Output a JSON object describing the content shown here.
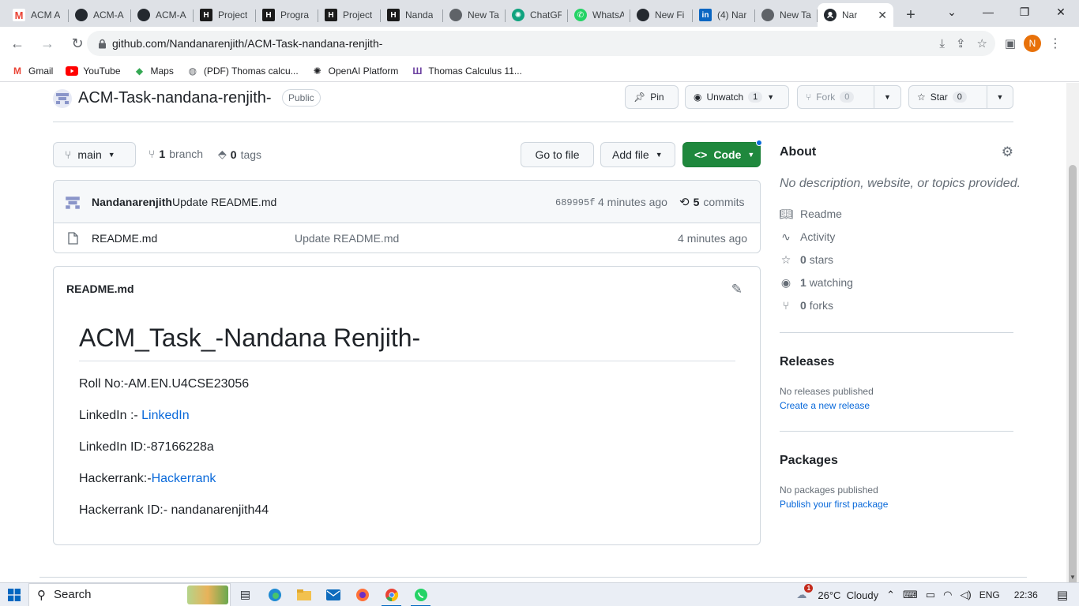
{
  "browser": {
    "tabs": [
      {
        "title": "ACM A",
        "icon": "gmail-icon",
        "color": "#ea4335"
      },
      {
        "title": "ACM-A",
        "icon": "github-icon",
        "color": "#24292f"
      },
      {
        "title": "ACM-A",
        "icon": "github-icon",
        "color": "#24292f"
      },
      {
        "title": "Project",
        "icon": "hackerrank-icon",
        "color": "#1a1a1a"
      },
      {
        "title": "Progra",
        "icon": "hackerrank-icon",
        "color": "#1a1a1a"
      },
      {
        "title": "Project",
        "icon": "hackerrank-icon",
        "color": "#1a1a1a"
      },
      {
        "title": "Nanda",
        "icon": "hackerrank-icon",
        "color": "#1a1a1a"
      },
      {
        "title": "New Ta",
        "icon": "chrome-icon",
        "color": "#5f6368"
      },
      {
        "title": "ChatGF",
        "icon": "chatgpt-icon",
        "color": "#10a37f"
      },
      {
        "title": "WhatsA",
        "icon": "whatsapp-icon",
        "color": "#25d366"
      },
      {
        "title": "New Fi",
        "icon": "github-icon",
        "color": "#24292f"
      },
      {
        "title": "(4) Nar",
        "icon": "linkedin-icon",
        "color": "#0a66c2"
      },
      {
        "title": "New Ta",
        "icon": "chrome-icon",
        "color": "#5f6368"
      }
    ],
    "active_tab": {
      "title": "Nar",
      "icon": "github-icon"
    },
    "url": "github.com/Nandanarenjith/ACM-Task-nandana-renjith-",
    "profile_initial": "N",
    "bookmarks": [
      {
        "label": "Gmail",
        "icon": "gmail-icon"
      },
      {
        "label": "YouTube",
        "icon": "youtube-icon"
      },
      {
        "label": "Maps",
        "icon": "maps-icon"
      },
      {
        "label": "(PDF) Thomas calcu...",
        "icon": "globe-icon"
      },
      {
        "label": "OpenAI Platform",
        "icon": "openai-icon"
      },
      {
        "label": "Thomas Calculus 11...",
        "icon": "book-icon"
      }
    ]
  },
  "repo": {
    "name": "ACM-Task-nandana-renjith-",
    "visibility": "Public",
    "pin_label": "Pin",
    "unwatch_label": "Unwatch",
    "watch_count": "1",
    "fork_label": "Fork",
    "fork_count": "0",
    "star_label": "Star",
    "star_count": "0",
    "branch_name": "main",
    "branch_count": "1",
    "branch_word": "branch",
    "tag_count": "0",
    "tag_word": "tags",
    "go_to_file": "Go to file",
    "add_file": "Add file",
    "code_label": "Code"
  },
  "commit": {
    "author": "Nandanarenjith",
    "message": "Update README.md",
    "sha": "689995f",
    "time": "4 minutes ago",
    "commit_count": "5",
    "commit_word": "commits"
  },
  "files": [
    {
      "name": "README.md",
      "message": "Update README.md",
      "time": "4 minutes ago"
    }
  ],
  "readme": {
    "filename": "README.md",
    "heading": "ACM_Task_-Nandana Renjith-",
    "roll": "Roll No:-AM.EN.U4CSE23056",
    "linkedin_prefix": "LinkedIn :- ",
    "linkedin_link": "LinkedIn",
    "linkedin_id": "LinkedIn ID:-87166228a",
    "hackerrank_prefix": "Hackerrank:-",
    "hackerrank_link": "Hackerrank",
    "hackerrank_id": "Hackerrank ID:- nandanarenjith44"
  },
  "about": {
    "title": "About",
    "description": "No description, website, or topics provided.",
    "readme": "Readme",
    "activity": "Activity",
    "stars_count": "0",
    "stars_word": "stars",
    "watching_count": "1",
    "watching_word": "watching",
    "forks_count": "0",
    "forks_word": "forks"
  },
  "releases": {
    "title": "Releases",
    "empty": "No releases published",
    "link": "Create a new release"
  },
  "packages": {
    "title": "Packages",
    "empty": "No packages published",
    "link": "Publish your first package"
  },
  "taskbar": {
    "search_label": "Search",
    "weather": "26°C  Cloudy",
    "weather_badge": "1",
    "language": "ENG",
    "time": "22:36"
  },
  "colors": {
    "github_green": "#1f883d",
    "link_blue": "#0969da",
    "border": "#d0d7de"
  }
}
